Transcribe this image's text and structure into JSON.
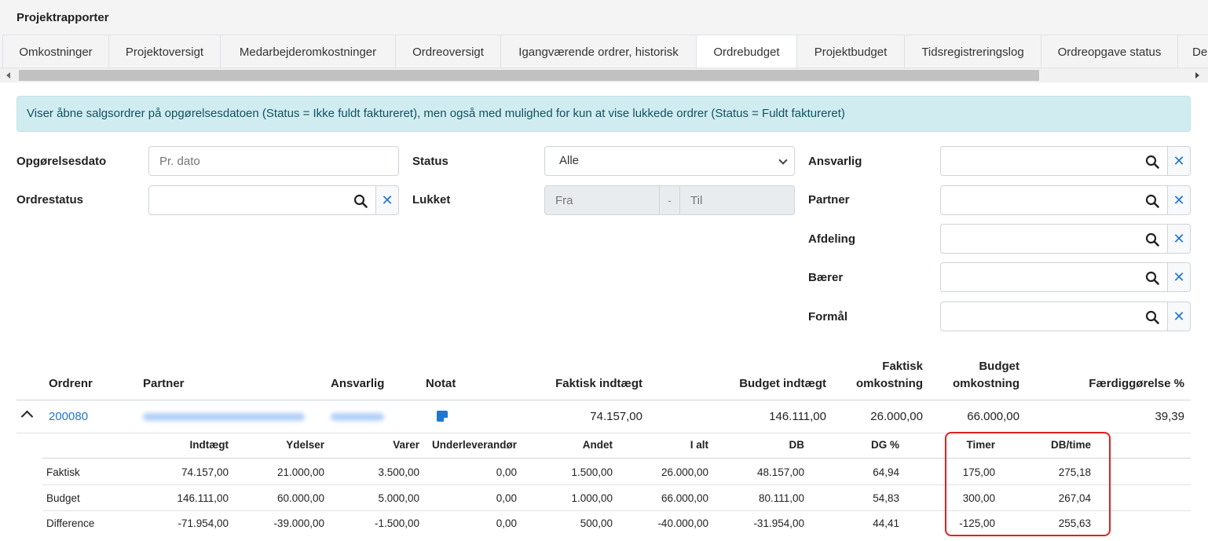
{
  "app": {
    "title": "Projektrapporter"
  },
  "tabs": [
    {
      "label": "Omkostninger"
    },
    {
      "label": "Projektoversigt"
    },
    {
      "label": "Medarbejderomkostninger"
    },
    {
      "label": "Ordreoversigt"
    },
    {
      "label": "Igangværende ordrer, historisk"
    },
    {
      "label": "Ordrebudget",
      "active": true
    },
    {
      "label": "Projektbudget"
    },
    {
      "label": "Tidsregistreringslog"
    },
    {
      "label": "Ordreopgave status"
    },
    {
      "label": "De"
    }
  ],
  "info": "Viser åbne salgsordrer på opgørelsesdatoen (Status = Ikke fuldt faktureret), men også med mulighed for kun at vise lukkede ordrer (Status = Fuldt faktureret)",
  "filters": {
    "opgorelsesdato": {
      "label": "Opgørelsesdato",
      "placeholder": "Pr. dato"
    },
    "ordrestatus": {
      "label": "Ordrestatus"
    },
    "status": {
      "label": "Status",
      "value": "Alle"
    },
    "lukket": {
      "label": "Lukket",
      "from": "Fra",
      "sep": "-",
      "to": "Til"
    },
    "ansvarlig": {
      "label": "Ansvarlig"
    },
    "partner": {
      "label": "Partner"
    },
    "afdeling": {
      "label": "Afdeling"
    },
    "baerer": {
      "label": "Bærer"
    },
    "formal": {
      "label": "Formål"
    }
  },
  "icons": {
    "search": "search-icon",
    "clear": "close-icon",
    "clear_glyph": "✕",
    "expand": "chevron-up-icon",
    "note": "note-icon"
  },
  "table": {
    "headers": {
      "ordrenr": "Ordrenr",
      "partner": "Partner",
      "ansvarlig": "Ansvarlig",
      "notat": "Notat",
      "faktisk_indtaegt": "Faktisk indtægt",
      "budget_indtaegt": "Budget indtægt",
      "faktisk_omk_1": "Faktisk",
      "faktisk_omk_2": "omkostning",
      "budget_omk_1": "Budget",
      "budget_omk_2": "omkostning",
      "faerdig": "Færdiggørelse %"
    },
    "row": {
      "ordrenr": "200080",
      "faktisk_indtaegt": "74.157,00",
      "budget_indtaegt": "146.111,00",
      "faktisk_omk": "26.000,00",
      "budget_omk": "66.000,00",
      "faerdig": "39,39"
    }
  },
  "detail": {
    "headers": [
      "Indtægt",
      "Ydelser",
      "Varer",
      "Underleverandør",
      "Andet",
      "I alt",
      "DB",
      "DG %",
      "Timer",
      "DB/time"
    ],
    "rows": [
      {
        "label": "Faktisk",
        "values": [
          "74.157,00",
          "21.000,00",
          "3.500,00",
          "0,00",
          "1.500,00",
          "26.000,00",
          "48.157,00",
          "64,94",
          "175,00",
          "275,18"
        ]
      },
      {
        "label": "Budget",
        "values": [
          "146.111,00",
          "60.000,00",
          "5.000,00",
          "0,00",
          "1.000,00",
          "66.000,00",
          "80.111,00",
          "54,83",
          "300,00",
          "267,04"
        ]
      },
      {
        "label": "Difference",
        "values": [
          "-71.954,00",
          "-39.000,00",
          "-1.500,00",
          "0,00",
          "500,00",
          "-40.000,00",
          "-31.954,00",
          "44,41",
          "-125,00",
          "255,63"
        ]
      }
    ]
  },
  "colors": {
    "accent": "#1f77d0",
    "highlight": "#e02020",
    "info_bg": "#d1ecf1"
  }
}
